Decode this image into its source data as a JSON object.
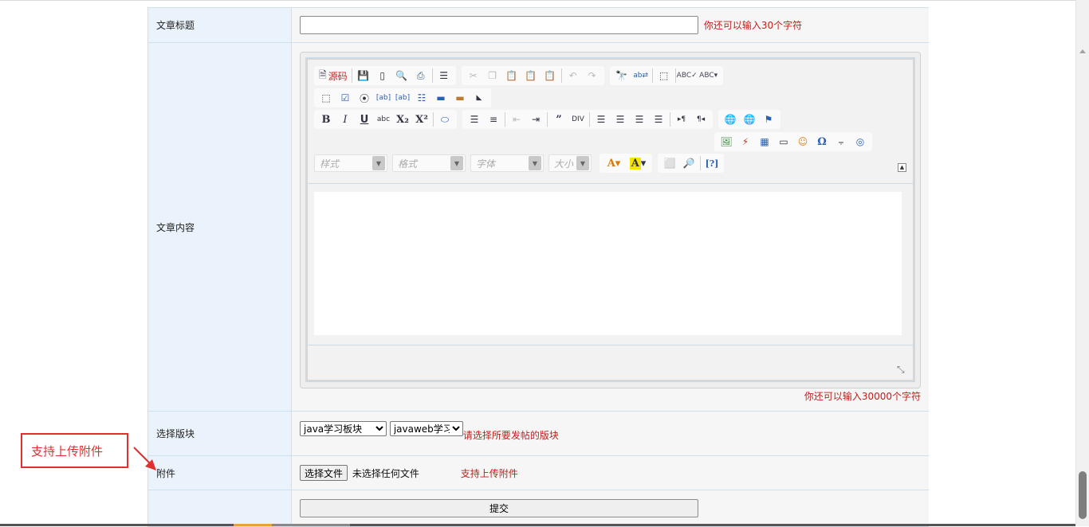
{
  "form": {
    "title_label": "文章标题",
    "title_value": "",
    "title_hint": "你还可以输入30个字符",
    "content_label": "文章内容",
    "content_hint": "你还可以输入30000个字符",
    "board_label": "选择版块",
    "board_primary": "java学习板块",
    "board_secondary": "javaweb学习",
    "board_hint": "请选择所要发帖的版块",
    "attachment_label": "附件",
    "file_button": "选择文件",
    "file_status": "未选择任何文件",
    "attachment_hint": "支持上传附件",
    "submit_label": "提交"
  },
  "editor": {
    "source_label": "源码",
    "style_placeholder": "样式",
    "format_placeholder": "格式",
    "font_placeholder": "字体",
    "size_placeholder": "大小",
    "row1": [
      "save-icon",
      "new-page-icon",
      "preview-icon",
      "print-icon",
      "templates-icon",
      "cut-icon",
      "copy-icon",
      "paste-icon",
      "paste-text-icon",
      "paste-word-icon",
      "undo-icon",
      "redo-icon",
      "find-icon",
      "replace-icon",
      "select-all-icon",
      "spellcheck-icon",
      "spellcheck-menu-icon"
    ],
    "row2": [
      "form-icon",
      "checkbox-icon",
      "radio-icon",
      "textfield-icon",
      "textarea-icon",
      "select-field-icon",
      "button-field-icon",
      "image-button-icon",
      "hidden-field-icon"
    ],
    "row3": [
      "bold-icon",
      "italic-icon",
      "underline-icon",
      "strike-icon",
      "subscript-icon",
      "superscript-icon",
      "remove-format-icon",
      "numbered-list-icon",
      "bulleted-list-icon",
      "outdent-icon",
      "indent-icon",
      "blockquote-icon",
      "div-icon",
      "align-left-icon",
      "align-center-icon",
      "align-right-icon",
      "justify-icon",
      "ltr-icon",
      "rtl-icon",
      "link-icon",
      "unlink-icon",
      "anchor-icon"
    ],
    "row4": [
      "image-icon",
      "flash-icon",
      "table-icon",
      "horizontal-rule-icon",
      "smiley-icon",
      "special-char-icon",
      "page-break-icon",
      "iframe-icon"
    ],
    "row5": [
      "text-color-icon",
      "bg-color-icon",
      "maximize-icon",
      "show-blocks-icon",
      "about-icon"
    ]
  },
  "annotation": {
    "callout_text": "支持上传附件"
  }
}
